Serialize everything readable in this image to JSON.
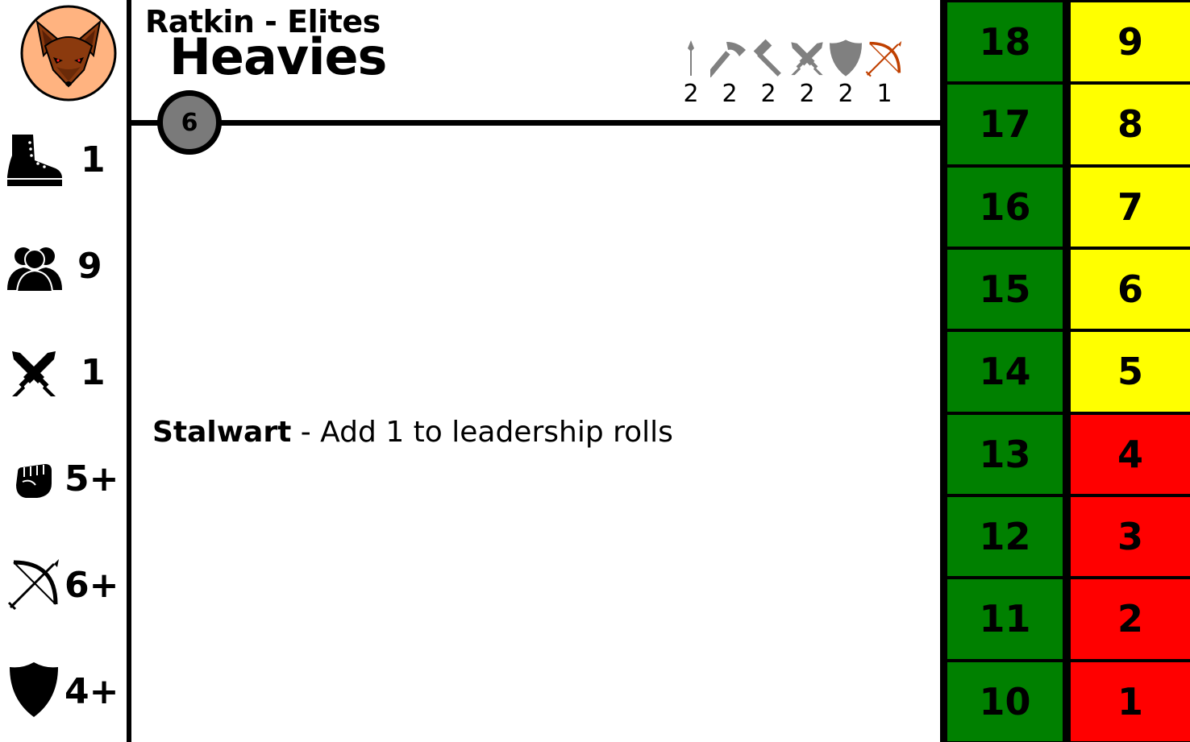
{
  "unit": {
    "faction_line": "Ratkin - Elites",
    "name": "Heavies",
    "cost": "6"
  },
  "stats": {
    "move": {
      "icon": "boot-icon",
      "value": "1"
    },
    "size": {
      "icon": "group-icon",
      "value": "9"
    },
    "attacks": {
      "icon": "crossed-swords-icon",
      "value": "1"
    },
    "melee": {
      "icon": "fist-icon",
      "value": "5+"
    },
    "ranged": {
      "icon": "bow-icon",
      "value": "6+"
    },
    "armour": {
      "icon": "shield-icon",
      "value": "4+"
    }
  },
  "equipment": [
    {
      "icon": "spear-icon",
      "count": "2",
      "color": "#808080"
    },
    {
      "icon": "axe-icon",
      "count": "2",
      "color": "#808080"
    },
    {
      "icon": "hammer-icon",
      "count": "2",
      "color": "#808080"
    },
    {
      "icon": "crossed-swords-icon",
      "count": "2",
      "color": "#808080"
    },
    {
      "icon": "shield-icon",
      "count": "2",
      "color": "#808080"
    },
    {
      "icon": "bow-icon",
      "count": "1",
      "color": "#c04000"
    }
  ],
  "rules": [
    {
      "name": "Stalwart",
      "text": " - Add 1 to leadership rolls"
    }
  ],
  "track": {
    "colors": {
      "green": "#008000",
      "yellow": "#ffff00",
      "red": "#ff0000"
    },
    "left_column": [
      "18",
      "17",
      "16",
      "15",
      "14",
      "13",
      "12",
      "11",
      "10"
    ],
    "right_column": [
      {
        "value": "9",
        "color": "yellow"
      },
      {
        "value": "8",
        "color": "yellow"
      },
      {
        "value": "7",
        "color": "yellow"
      },
      {
        "value": "6",
        "color": "yellow"
      },
      {
        "value": "5",
        "color": "yellow"
      },
      {
        "value": "4",
        "color": "red"
      },
      {
        "value": "3",
        "color": "red"
      },
      {
        "value": "2",
        "color": "red"
      },
      {
        "value": "1",
        "color": "red"
      }
    ]
  }
}
